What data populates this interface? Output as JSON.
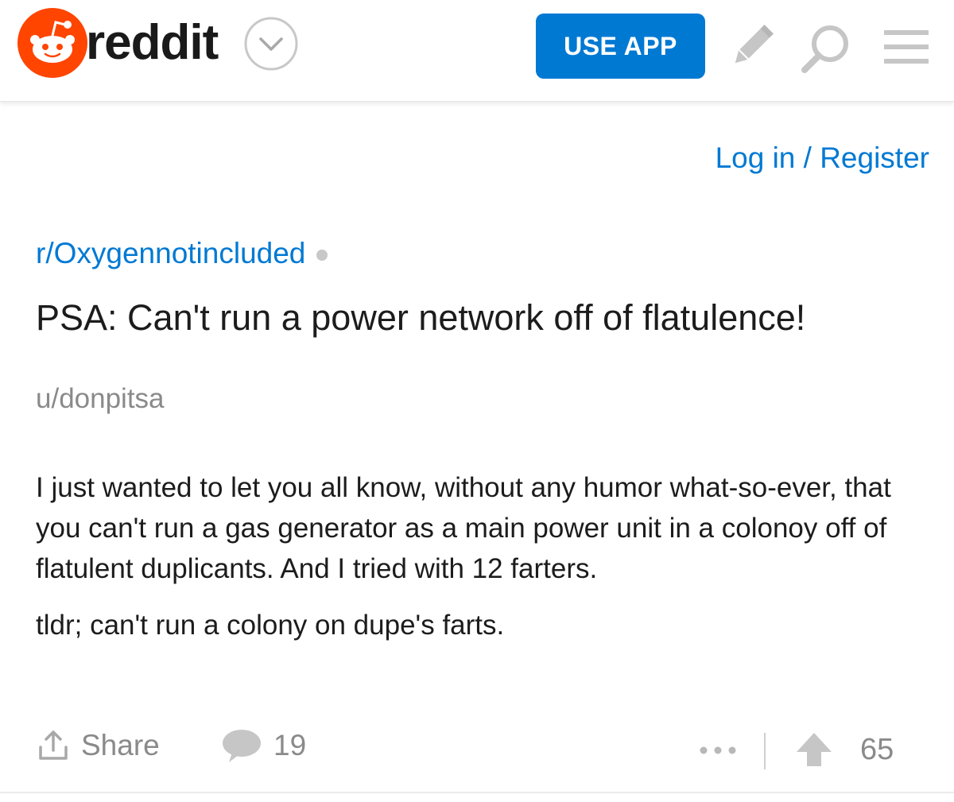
{
  "header": {
    "brand": "reddit",
    "use_app_label": "USE APP",
    "brand_color": "#ff4500",
    "accent_color": "#0079d3",
    "icons": [
      "snoo-logo-icon",
      "chevron-down-icon",
      "pencil-icon",
      "search-icon",
      "hamburger-menu-icon"
    ]
  },
  "auth": {
    "login_label": "Log in / Register"
  },
  "post": {
    "subreddit": "r/Oxygennotincluded",
    "title": "PSA: Can't run a power network off of flatulence!",
    "author": "u/donpitsa",
    "body": [
      "I just wanted to let you all know, without any humor what-so-ever, that you can't run a gas generator as a main power unit in a colonoy off of flatulent duplicants. And I tried with 12 farters.",
      "tldr; can't run a colony on dupe's farts."
    ],
    "actions": {
      "share_label": "Share",
      "comment_count": "19",
      "score": "65"
    }
  }
}
